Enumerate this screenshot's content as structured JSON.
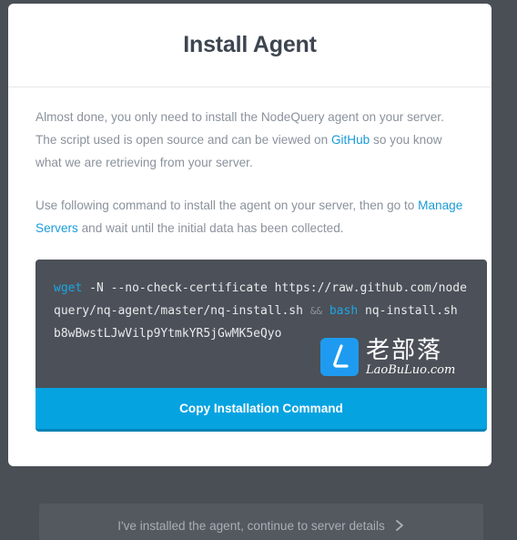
{
  "modal": {
    "title": "Install Agent",
    "para1": {
      "before_link": "Almost done, you only need to install the NodeQuery agent on your server. The script used is open source and can be viewed on ",
      "link": "GitHub",
      "after_link": " so you know what we are retrieving from your server."
    },
    "para2": {
      "before_link": "Use following command to install the agent on your server, then go to ",
      "link": "Manage Servers",
      "after_link": " and wait until the initial data has been collected."
    },
    "command": {
      "wget": "wget",
      "part1": " -N --no-check-certificate https://raw.github.com/nodequery/nq-agent/master/nq-install.sh ",
      "and_op": "&&",
      "bash": "bash",
      "part2": " nq-install.sh b8wBwstLJwVilp9YtmkYR5jGwMK5eQyo"
    },
    "copy_button_label": "Copy Installation Command"
  },
  "watermark": {
    "logo_letter": "L",
    "cn_text": "老部落",
    "en_text": "LaoBuLuo.com"
  },
  "continue_label": "I've installed the agent, continue to server details",
  "icons": {
    "continue": "chevron-right-icon"
  },
  "colors": {
    "link": "#1a9bd7",
    "copy_button": "#06a3e1",
    "code_background": "#4c5058",
    "backdrop": "#4a4e55"
  }
}
